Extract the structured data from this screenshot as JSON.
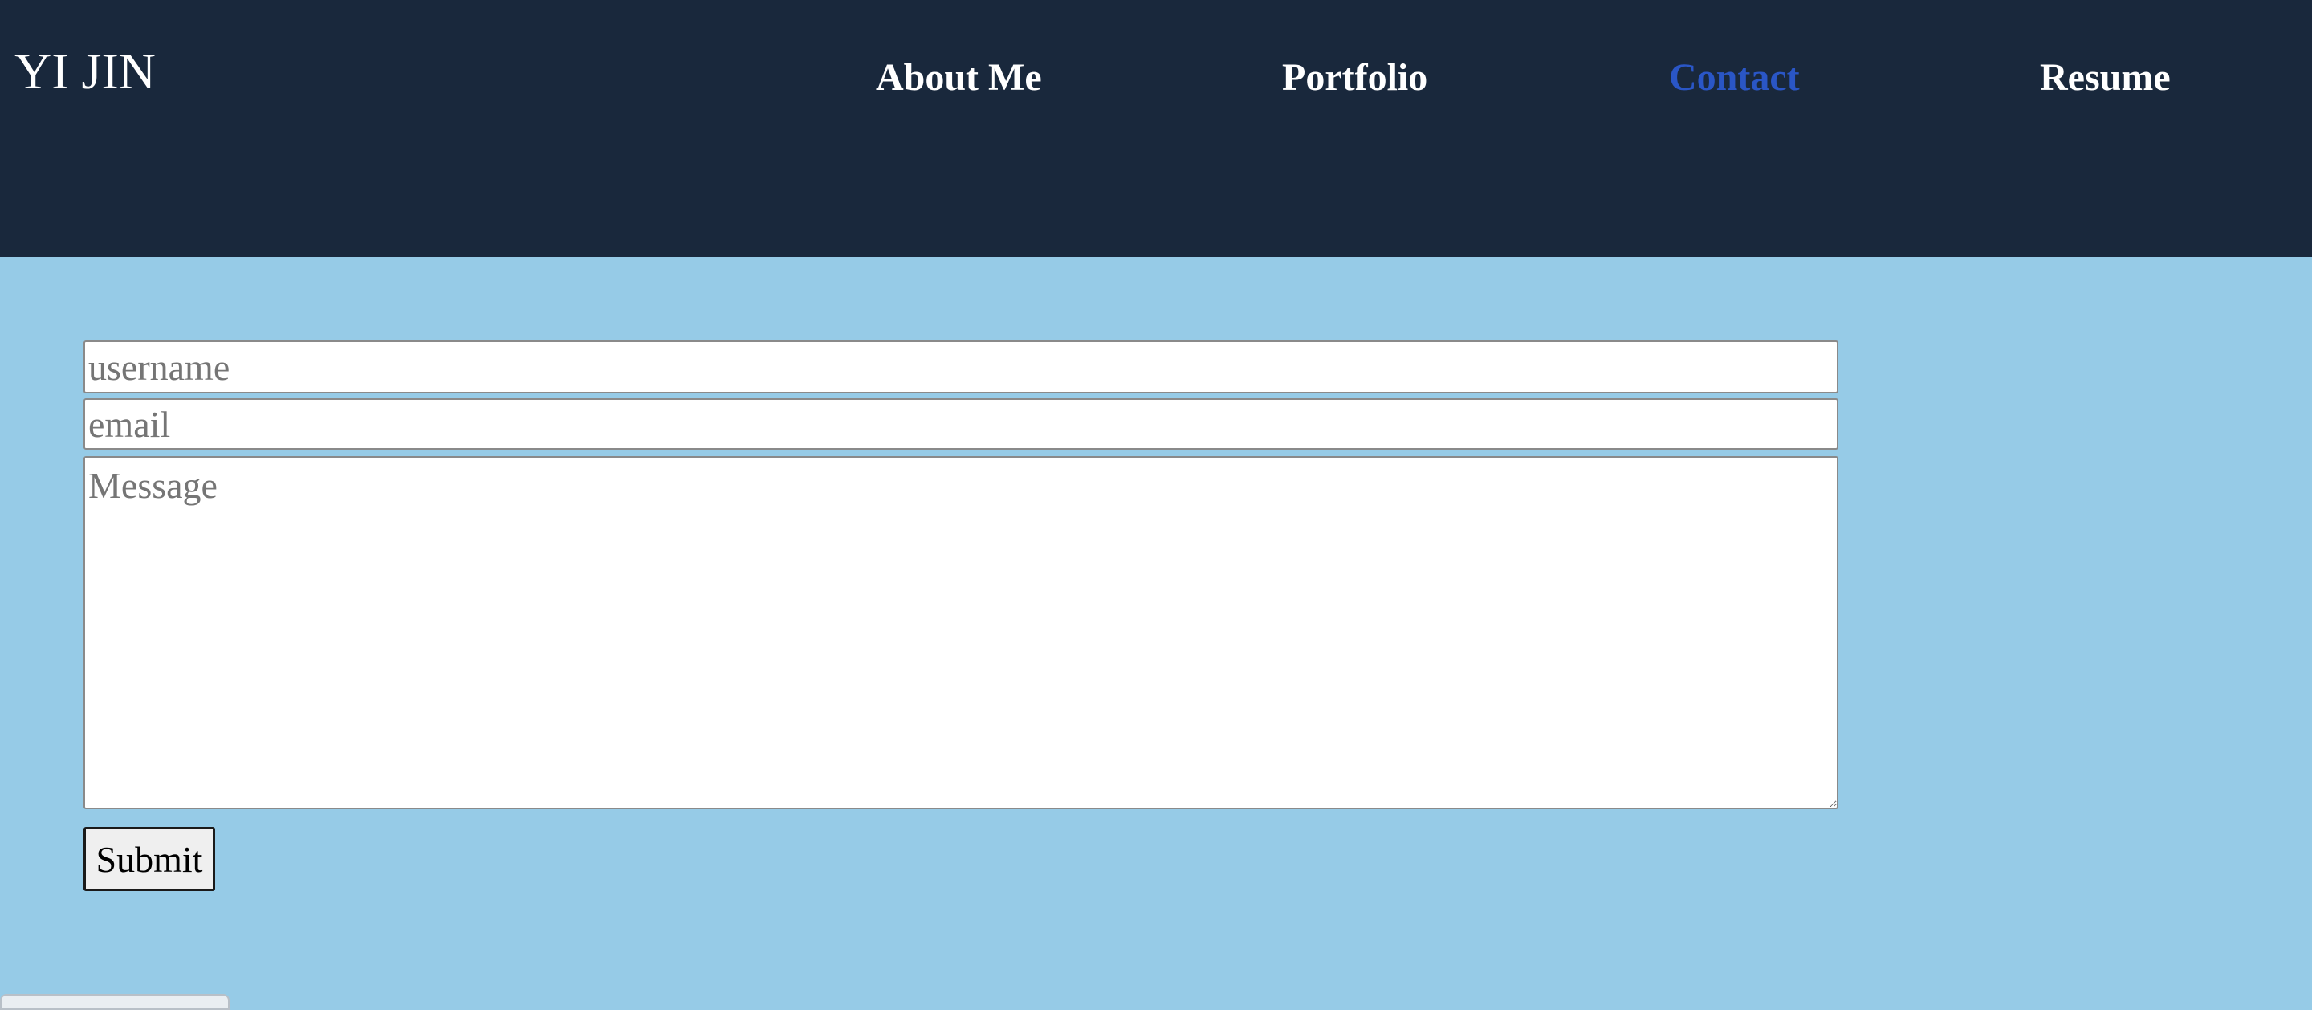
{
  "header": {
    "brand": "YI JIN",
    "nav": [
      {
        "label": "About Me",
        "active": false
      },
      {
        "label": "Portfolio",
        "active": false
      },
      {
        "label": "Contact",
        "active": true
      },
      {
        "label": "Resume",
        "active": false
      }
    ]
  },
  "form": {
    "username_placeholder": "username",
    "email_placeholder": "email",
    "message_placeholder": "Message",
    "submit_label": "Submit"
  },
  "colors": {
    "header_bg": "#19283c",
    "page_bg": "#96cbe7",
    "nav_text": "#ffffff",
    "nav_active": "#2a56c6"
  }
}
